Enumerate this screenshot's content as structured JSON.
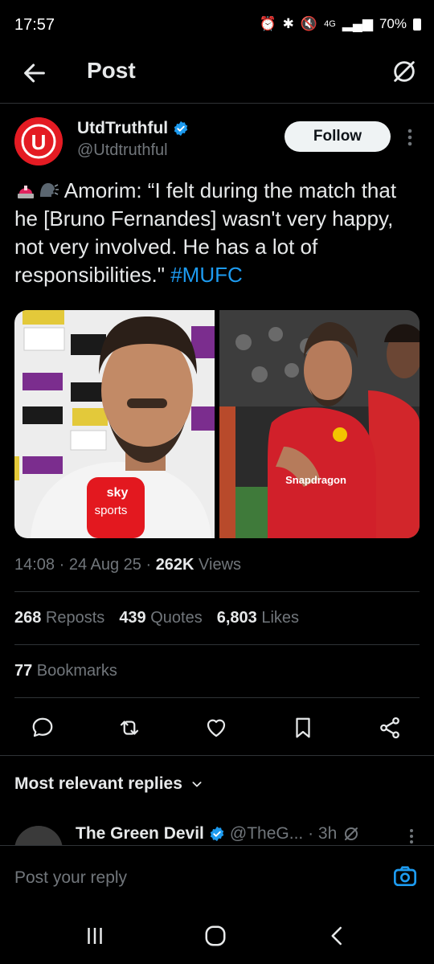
{
  "status_bar": {
    "time": "17:57",
    "network": "4G",
    "battery": "70%"
  },
  "header": {
    "title": "Post"
  },
  "post": {
    "author": {
      "display_name": "UtdTruthful",
      "handle": "@Utdtruthful",
      "verified": true
    },
    "follow_label": "Follow",
    "text_main": "Amorim: “I felt during the match that he [Bruno Fernandes] wasn't very happy, not very involved. He has a lot of responsibilities.\" ",
    "hashtag": "#MUFC",
    "emojis": [
      "siren-icon",
      "speaking-head-icon"
    ],
    "media": [
      {
        "description_icon": "interview-photo",
        "mic_text_1": "sky",
        "mic_text_2": "sports"
      },
      {
        "description_icon": "player-photo",
        "shirt_text": "Snapdragon"
      }
    ],
    "timestamp": "14:08 · 24 Aug 25 · ",
    "views_count": "262K",
    "views_label": " Views",
    "reposts_count": "268",
    "reposts_label": " Reposts",
    "quotes_count": "439",
    "quotes_label": " Quotes",
    "likes_count": "6,803",
    "likes_label": " Likes",
    "bookmarks_count": "77",
    "bookmarks_label": " Bookmarks"
  },
  "replies": {
    "sort_label": "Most relevant replies",
    "first": {
      "display_name": "The Green Devil",
      "handle_time": "@TheG... · 3h"
    }
  },
  "compose": {
    "placeholder": "Post your reply"
  },
  "colors": {
    "accent": "#1d9bf0",
    "background": "#000000",
    "muted": "#71767b",
    "brand_red": "#e41b23"
  }
}
